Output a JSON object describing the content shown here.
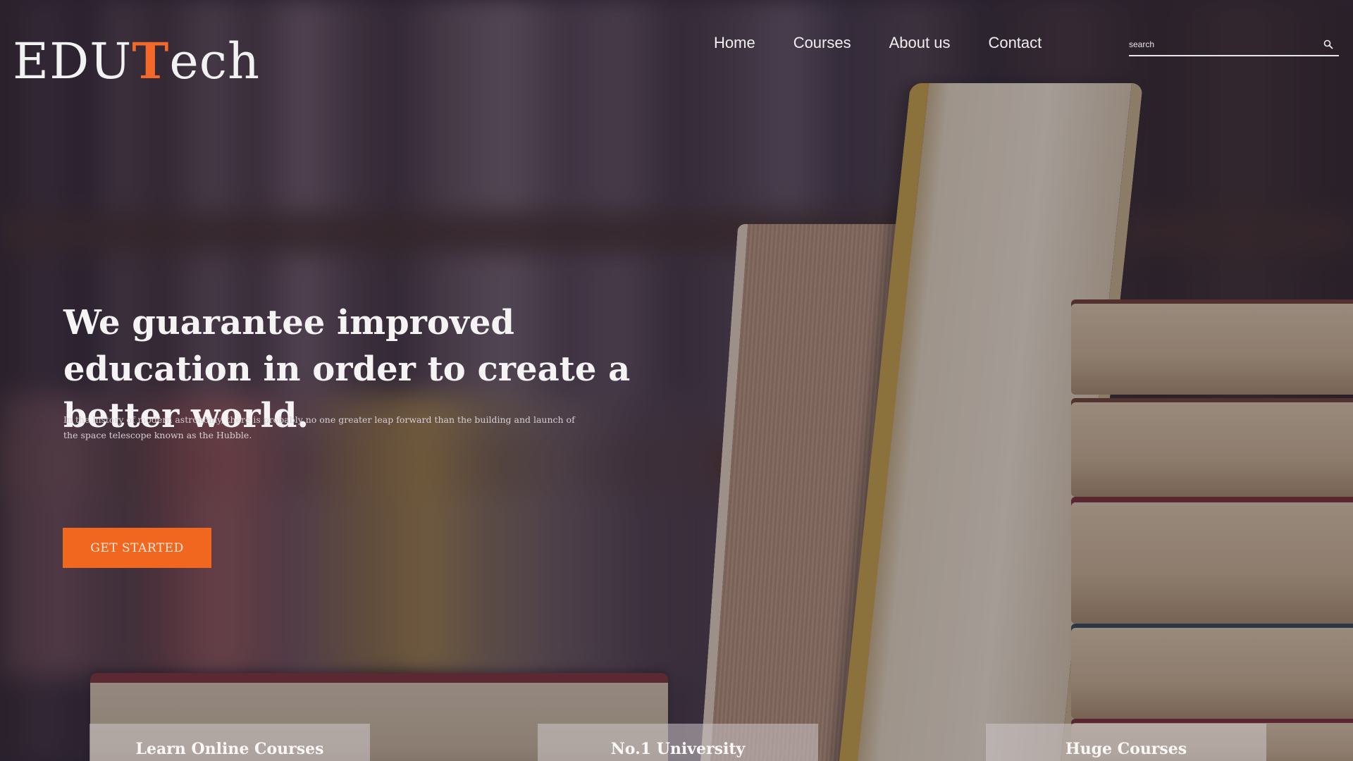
{
  "brand": {
    "logo_prefix": "EDU",
    "logo_accent": "T",
    "logo_suffix": "ech",
    "accent_color": "#f2671f"
  },
  "nav": {
    "items": [
      {
        "label": "Home"
      },
      {
        "label": "Courses"
      },
      {
        "label": "About us"
      },
      {
        "label": "Contact"
      }
    ]
  },
  "search": {
    "placeholder": "search",
    "icon": "search-icon"
  },
  "hero": {
    "title": "We guarantee improved education in order to create a better world.",
    "body": "In the history of modern astronomy, there is probably no one greater leap forward than the building and launch of the space telescope known as the Hubble.",
    "cta_label": "GET STARTED"
  },
  "features": [
    {
      "label": "Learn Online Courses"
    },
    {
      "label": "No.1 University"
    },
    {
      "label": "Huge Courses"
    }
  ]
}
